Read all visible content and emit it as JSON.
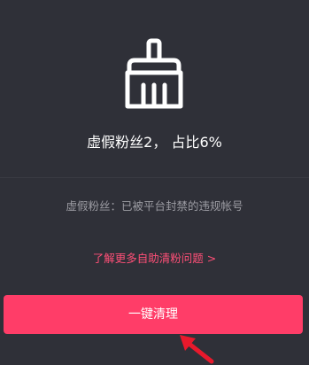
{
  "icon": "broom-icon",
  "headline": "虚假粉丝2，  占比6%",
  "description": "虚假粉丝：已被平台封禁的违规帐号",
  "help_link": {
    "label": "了解更多自助清粉问题",
    "chevron": ">"
  },
  "clean_button": {
    "label": "一键清理"
  },
  "annotation": "red-arrow-icon",
  "colors": {
    "background": "#2f3038",
    "accent": "#ff3d68",
    "link": "#ff4f77",
    "arrow": "#e8192c"
  }
}
